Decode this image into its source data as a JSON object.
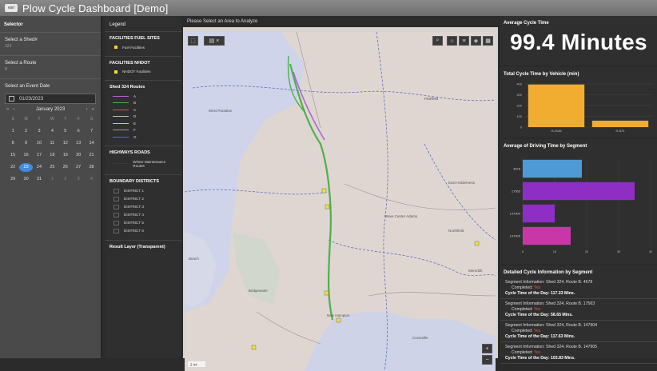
{
  "header": {
    "logo_text": "esri",
    "title": "Plow Cycle Dashboard [Demo]"
  },
  "selector": {
    "title": "Selector",
    "shed": {
      "label": "Select a Shed#",
      "value": "324"
    },
    "route": {
      "label": "Select a Route",
      "value": "B"
    },
    "event_date": {
      "label": "Select an Event Date",
      "value": "01/23/2023"
    },
    "calendar": {
      "month": "January 2023",
      "prev_year": "«",
      "prev": "‹",
      "next": "›",
      "next_year": "»",
      "dow": [
        "S",
        "M",
        "T",
        "W",
        "T",
        "F",
        "S"
      ],
      "days": [
        "1",
        "2",
        "3",
        "4",
        "5",
        "6",
        "7",
        "8",
        "9",
        "10",
        "11",
        "12",
        "13",
        "14",
        "15",
        "16",
        "17",
        "18",
        "19",
        "20",
        "21",
        "22",
        "23",
        "24",
        "25",
        "26",
        "27",
        "28",
        "29",
        "30",
        "31",
        "1",
        "2",
        "3",
        "4"
      ],
      "selected_day": "23"
    }
  },
  "legend": {
    "title": "Legend",
    "fuel": {
      "heading": "FACILITIES FUEL SITES",
      "item": "Fuel Facilities",
      "color": "#f0d43a"
    },
    "nhdot": {
      "heading": "FACILITIES NHDOT",
      "item": "NHDOT Facilities",
      "color": "#f0e040"
    },
    "routes": {
      "heading": "Shed 324 Routes",
      "items": [
        {
          "label": "A",
          "color": "#b265d6"
        },
        {
          "label": "B",
          "color": "#4cb04c"
        },
        {
          "label": "C",
          "color": "#e05050"
        },
        {
          "label": "D",
          "color": "#bfbfbf"
        },
        {
          "label": "E",
          "color": "#e6c94a"
        },
        {
          "label": "F",
          "color": "#9a9a9a"
        },
        {
          "label": "G",
          "color": "#4f6fd0"
        }
      ]
    },
    "highways": {
      "heading": "HIGHWAYS ROADS",
      "item": "Winter Maintenance Routes"
    },
    "districts": {
      "heading": "BOUNDARY DISTRICTS",
      "items": [
        "DISTRICT 1",
        "DISTRICT 2",
        "DISTRICT 3",
        "DISTRICT 4",
        "DISTRICT 5",
        "DISTRICT 6"
      ]
    },
    "result": {
      "heading": "Result Layer (Transparent)"
    }
  },
  "map": {
    "title": "Please Select an Area to Analyze",
    "labels": [
      "West Paradise",
      "Pinkfield",
      "East Holderness",
      "Wave Center Adams",
      "Northfield",
      "Meredith",
      "Beach",
      "Bridgewater",
      "New Hampton",
      "Crossville"
    ],
    "scale": "2 mi"
  },
  "kpi": {
    "title": "Average Cycle Time",
    "value": "99.4 Minutes"
  },
  "chart_data": [
    {
      "type": "bar",
      "title": "Total Cycle Time by Vehicle (min)",
      "categories": [
        "H-2146",
        "H-571"
      ],
      "values": [
        395,
        60
      ],
      "ylim": [
        0,
        400
      ],
      "yticks": [
        0,
        100,
        200,
        300,
        400
      ],
      "color": "#f0ad30"
    },
    {
      "type": "bar",
      "orientation": "horizontal",
      "title": "Average of Driving Time by Segment",
      "categories": [
        "4678",
        "17563",
        "147904",
        "147905"
      ],
      "values": [
        18.5,
        35,
        10,
        15
      ],
      "xlim": [
        0,
        40
      ],
      "xticks": [
        0,
        10,
        20,
        30,
        40
      ],
      "colors": [
        "#4e9ad6",
        "#8e2ec4",
        "#8e2ec4",
        "#c837a8"
      ]
    }
  ],
  "details": {
    "title": "Detailed Cycle Information by Segment",
    "items": [
      {
        "info": "Segment Information: Shed 324, Route B. 4678",
        "completed_label": "Completed:",
        "completed": "Yes",
        "cycle": "Cycle Time of the Day: 117.33 Mins."
      },
      {
        "info": "Segment Information: Shed 324, Route B. 17563",
        "completed_label": "Completed:",
        "completed": "Yes",
        "cycle": "Cycle Time of the Day: 58.65 Mins."
      },
      {
        "info": "Segment Information: Shed 324, Route B. 147904",
        "completed_label": "Completed:",
        "completed": "Yes",
        "cycle": "Cycle Time of the Day: 117.63 Mins."
      },
      {
        "info": "Segment Information: Shed 324, Route B. 147905",
        "completed_label": "Completed:",
        "completed": "Yes",
        "cycle": "Cycle Time of the Day: 103.83 Mins."
      }
    ]
  }
}
